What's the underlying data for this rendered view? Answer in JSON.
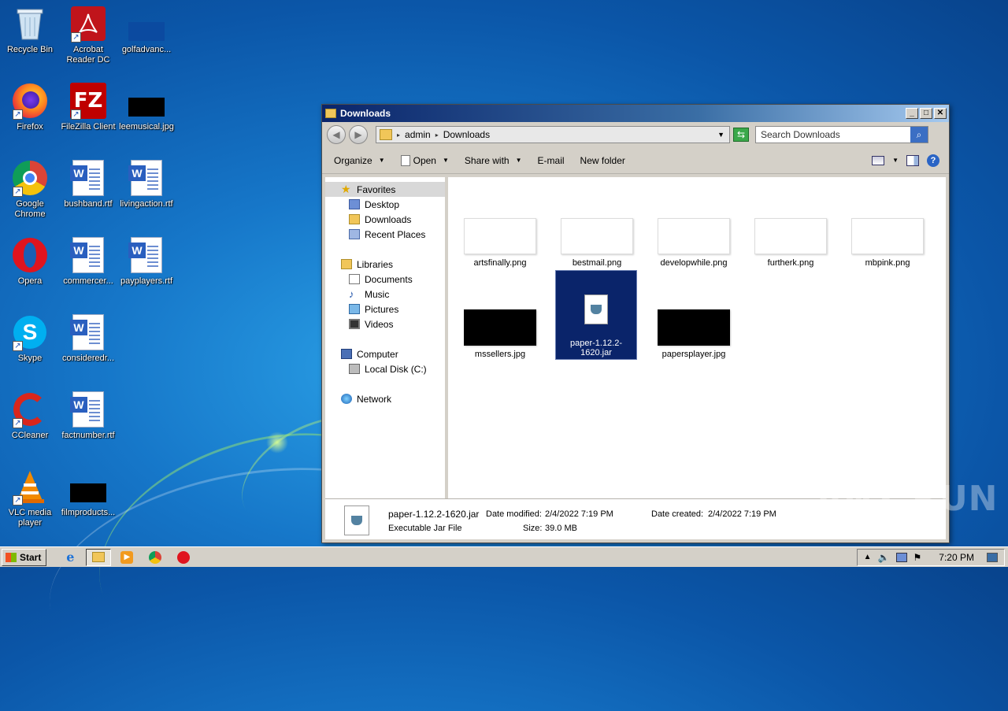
{
  "desktop": {
    "icons": [
      {
        "label": "Recycle Bin",
        "icon": "recycle-bin-icon"
      },
      {
        "label": "Acrobat Reader DC",
        "icon": "acrobat-icon"
      },
      {
        "label": "golfadvanc...",
        "icon": "image-thumbnail-icon"
      },
      {
        "label": "Firefox",
        "icon": "firefox-icon"
      },
      {
        "label": "FileZilla Client",
        "icon": "filezilla-icon"
      },
      {
        "label": "leemusical.jpg",
        "icon": "image-thumbnail-icon"
      },
      {
        "label": "Google Chrome",
        "icon": "chrome-icon"
      },
      {
        "label": "bushband.rtf",
        "icon": "word-doc-icon"
      },
      {
        "label": "livingaction.rtf",
        "icon": "word-doc-icon"
      },
      {
        "label": "Opera",
        "icon": "opera-icon"
      },
      {
        "label": "commercer...",
        "icon": "word-doc-icon"
      },
      {
        "label": "payplayers.rtf",
        "icon": "word-doc-icon"
      },
      {
        "label": "Skype",
        "icon": "skype-icon"
      },
      {
        "label": "consideredr...",
        "icon": "word-doc-icon"
      },
      {
        "label": "CCleaner",
        "icon": "ccleaner-icon"
      },
      {
        "label": "factnumber.rtf",
        "icon": "word-doc-icon"
      },
      {
        "label": "VLC media player",
        "icon": "vlc-icon"
      },
      {
        "label": "filmproducts...",
        "icon": "image-thumbnail-icon"
      }
    ]
  },
  "window": {
    "title": "Downloads",
    "address": {
      "segments": [
        "admin",
        "Downloads"
      ]
    },
    "search_placeholder": "Search Downloads",
    "toolbar": {
      "organize": "Organize",
      "open": "Open",
      "share_with": "Share with",
      "email": "E-mail",
      "new_folder": "New folder"
    },
    "nav": {
      "favorites": "Favorites",
      "desktop": "Desktop",
      "downloads": "Downloads",
      "recent_places": "Recent Places",
      "libraries": "Libraries",
      "documents": "Documents",
      "music": "Music",
      "pictures": "Pictures",
      "videos": "Videos",
      "computer": "Computer",
      "local_disk": "Local Disk (C:)",
      "network": "Network"
    },
    "files": [
      {
        "name": "artsfinally.png",
        "thumb": "white"
      },
      {
        "name": "bestmail.png",
        "thumb": "white"
      },
      {
        "name": "developwhile.png",
        "thumb": "white"
      },
      {
        "name": "furtherk.png",
        "thumb": "white"
      },
      {
        "name": "mbpink.png",
        "thumb": "white"
      },
      {
        "name": "mssellers.jpg",
        "thumb": "black"
      },
      {
        "name": "paper-1.12.2-1620.jar",
        "thumb": "jar",
        "selected": true
      },
      {
        "name": "papersplayer.jpg",
        "thumb": "black"
      }
    ],
    "details": {
      "filename": "paper-1.12.2-1620.jar",
      "type": "Executable Jar File",
      "date_modified_label": "Date modified:",
      "date_modified": "2/4/2022 7:19 PM",
      "size_label": "Size:",
      "size": "39.0 MB",
      "date_created_label": "Date created:",
      "date_created": "2/4/2022 7:19 PM"
    }
  },
  "taskbar": {
    "start_label": "Start",
    "clock": "7:20 PM"
  },
  "watermark": "ANY RUN"
}
